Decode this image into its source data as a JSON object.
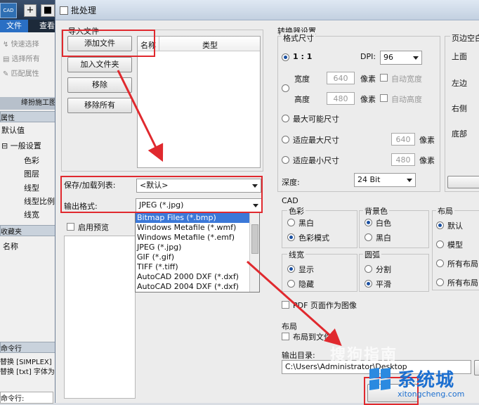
{
  "bg_app": {
    "logo": "CAD",
    "tab_file": "文件",
    "tab_view": "查看",
    "quick_select": "快速选择",
    "select_all": "选择所有",
    "match_prop": "匹配属性",
    "panel_title": "绛扮施工图",
    "properties_hdr": "属性",
    "default_value": "默认值",
    "general": "一般设置",
    "props": [
      "色彩",
      "图层",
      "线型",
      "线型比例",
      "线宽"
    ],
    "favorites_hdr": "收藏夹",
    "name_col": "名称",
    "cmdline_hdr": "命令行",
    "cmd_lines": [
      "替换 [SIMPLEX]",
      "替换 [txt] 字体为"
    ],
    "cmd_prompt": "命令行:"
  },
  "dialog": {
    "title": "批处理",
    "import_group": "导入文件",
    "btn_add_file": "添加文件",
    "btn_add_folder": "加入文件夹",
    "btn_remove": "移除",
    "btn_remove_all": "移除所有",
    "col_name": "名称",
    "col_type": "类型",
    "save_load_label": "保存/加载列表:",
    "save_load_value": "<默认>",
    "output_format_label": "输出格式:",
    "output_format_value": "JPEG (*.jpg)",
    "format_options": [
      "Bitmap Files (*.bmp)",
      "Windows Metafile (*.wmf)",
      "Windows Metafile (*.emf)",
      "JPEG (*.jpg)",
      "GIF (*.gif)",
      "TIFF (*.tiff)",
      "AutoCAD 2000 DXF (*.dxf)",
      "AutoCAD 2004 DXF (*.dxf)"
    ],
    "preview_label": "启用预览",
    "converter_settings": "转换器设置",
    "size_group": "格式尺寸",
    "ratio": "1 : 1",
    "dpi_label": "DPI:",
    "dpi_value": "96",
    "width_label": "宽度",
    "width_value": "640",
    "height_label": "高度",
    "height_value": "480",
    "pixel_unit": "像素",
    "auto_width": "自动宽度",
    "auto_height": "自动高度",
    "max_size": "最大可能尺寸",
    "fit_max": "适应最大尺寸",
    "fit_max_value": "640",
    "fit_min": "适应最小尺寸",
    "fit_min_value": "480",
    "depth_label": "深度:",
    "depth_value": "24 Bit",
    "margins_group": "页边空白",
    "margin_top": "上面",
    "margin_left": "左边",
    "margin_right": "右侧",
    "margin_bottom": "底部",
    "cad_group": "CAD",
    "color_group": "色彩",
    "color_bw": "黑白",
    "color_mode": "色彩模式",
    "bg_group": "背景色",
    "bg_white": "白色",
    "bg_black": "黑白",
    "layout_group": "布局",
    "layout_default": "默认",
    "layout_model": "模型",
    "layout_all": "所有布局",
    "layout_all2": "所有布局+",
    "lw_group": "线宽",
    "lw_show": "显示",
    "lw_hide": "隐藏",
    "arc_group": "圆弧",
    "arc_split": "分割",
    "arc_smooth": "平滑",
    "pdf_as_image": "PDF 页面作为图像",
    "layout2_group": "布局",
    "layout_to_file": "布局到文件",
    "output_dir_label": "输出目录:",
    "output_dir_value": "C:\\Users\\Administrator\\Desktop"
  },
  "watermark": {
    "sogou": "搜狗指南",
    "brand": "系统城",
    "site": "xitongcheng.com"
  },
  "colors": {
    "annotation_red": "#e0292e"
  }
}
